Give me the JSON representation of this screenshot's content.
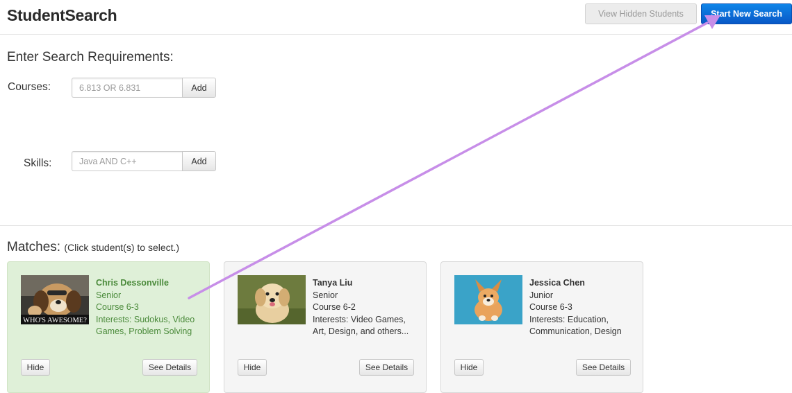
{
  "header": {
    "app_title": "StudentSearch",
    "view_hidden_label": "View Hidden Students",
    "start_new_label": "Start New Search"
  },
  "search": {
    "title": "Enter Search Requirements:",
    "courses": {
      "label": "Courses:",
      "placeholder": "6.813 OR 6.831",
      "add_label": "Add"
    },
    "skills": {
      "label": "Skills:",
      "placeholder": "Java AND C++",
      "add_label": "Add"
    }
  },
  "matches": {
    "title": "Matches:",
    "hint": "(Click student(s) to select.)",
    "students": [
      {
        "name": "Chris Dessonville",
        "year": "Senior",
        "course": "Course 6-3",
        "interests": "Interests: Sudokus, Video Games, Problem Solving",
        "photo_caption": "WHO'S AWESOME?",
        "selected": true,
        "hide_label": "Hide",
        "details_label": "See Details"
      },
      {
        "name": "Tanya Liu",
        "year": "Senior",
        "course": "Course 6-2",
        "interests": "Interests: Video Games, Art, Design, and others...",
        "selected": false,
        "hide_label": "Hide",
        "details_label": "See Details"
      },
      {
        "name": "Jessica Chen",
        "year": "Junior",
        "course": "Course 6-3",
        "interests": "Interests: Education, Communication, Design",
        "selected": false,
        "hide_label": "Hide",
        "details_label": "See Details"
      }
    ]
  },
  "colors": {
    "primary_button": "#0a6ad8",
    "selected_card": "#dff0d8",
    "annotation_arrow": "#c78ee8"
  }
}
